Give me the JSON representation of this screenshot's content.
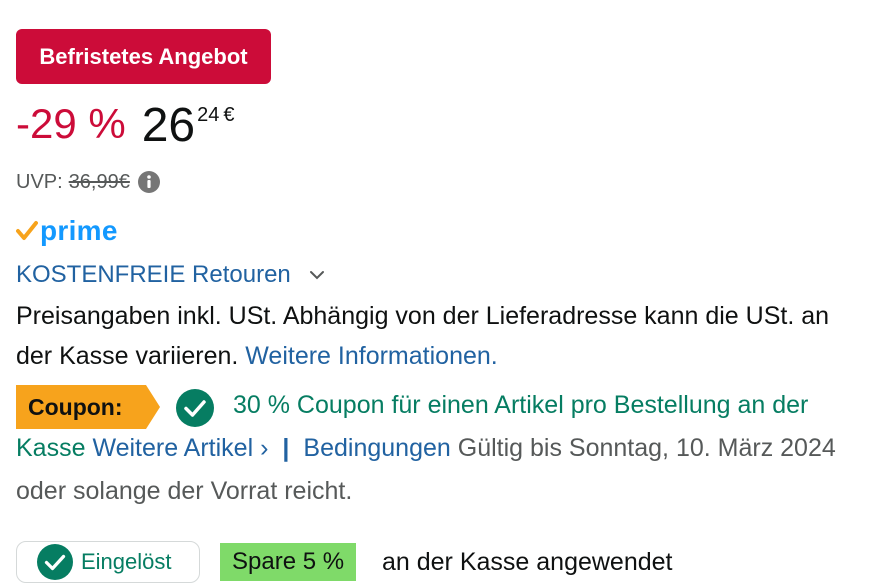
{
  "deal": {
    "badge": "Befristetes Angebot"
  },
  "price": {
    "discount": "-29 %",
    "whole": "26",
    "fraction": "24",
    "currency": "€",
    "uvp_label": "UVP:",
    "uvp_value": "36,99€"
  },
  "prime": {
    "label": "prime",
    "check_color": "#f7a31c",
    "text_color": "#1399ff"
  },
  "returns": {
    "label": "KOSTENFREIE Retouren"
  },
  "vat": {
    "text": "Preisangaben inkl. USt. Abhängig von der Lieferadresse kann die USt. an der Kasse variieren.",
    "link": "Weitere Informationen."
  },
  "coupon": {
    "label": "Coupon:",
    "offer": "30 % Coupon für einen Artikel pro Bestellung an der Kasse",
    "more_items_link": "Weitere Artikel ›",
    "separator": "|",
    "terms_link": "Bedingungen",
    "validity": "Gültig bis Sonntag, 10. März 2024 oder solange der Vorrat reicht."
  },
  "redeemed": {
    "label": "Eingelöst"
  },
  "savings": {
    "badge": "Spare 5 %",
    "text": "an der Kasse angewendet"
  }
}
